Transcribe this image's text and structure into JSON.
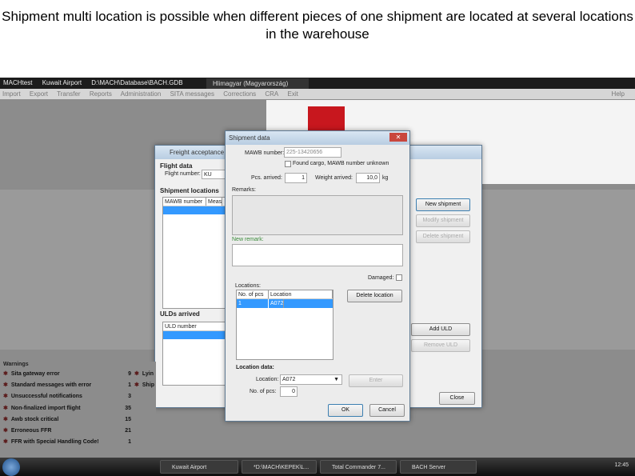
{
  "caption": "Shipment multi location is possible when different pieces of one shipment are located at several locations in the warehouse",
  "app": {
    "titlebar": [
      "MACHtest",
      "Kuwait Airport",
      "D:\\MACH\\Database\\BACH.GDB"
    ],
    "user": "Hlimagyar (Magyarország)",
    "menu": [
      "Import",
      "Export",
      "Transfer",
      "Reports",
      "Administration",
      "SITA messages",
      "Corrections",
      "CRA",
      "Exit"
    ],
    "help": "Help"
  },
  "freight": {
    "title": "Freight acceptance fo",
    "flight_data": "Flight data",
    "flight_number_label": "Flight number:",
    "flight_number": "KU",
    "shipment_locations": "Shipment locations",
    "cols": [
      "MAWB number",
      "Meas"
    ],
    "ulds_arrived": "ULDs arrived",
    "uld_col": "ULD number",
    "buttons": {
      "new": "New shipment",
      "modify": "Modify shipment",
      "delete": "Delete shipment",
      "add_uld": "Add ULD",
      "remove_uld": "Remove ULD",
      "close": "Close"
    }
  },
  "dialog": {
    "title": "Shipment data",
    "mawb_label": "MAWB number:",
    "mawb": "225-13420656",
    "found_cargo": "Found cargo, MAWB number unknown",
    "pcs_label": "Pcs. arrived:",
    "pcs": "1",
    "weight_label": "Weight arrived:",
    "weight": "10,0",
    "unit": "kg",
    "remarks": "Remarks:",
    "new_remark": "New remark:",
    "damaged": "Damaged:",
    "locations": "Locations:",
    "loc_cols": [
      "No. of pcs",
      "Location"
    ],
    "loc_rows": [
      {
        "pcs": "1",
        "location": "A072"
      }
    ],
    "delete_location": "Delete location",
    "location_data": "Location data:",
    "location_label": "Location:",
    "location": "A072",
    "enter": "Enter",
    "no_pcs_label": "No. of pcs:",
    "no_pcs": "0",
    "ok": "OK",
    "cancel": "Cancel"
  },
  "warnings": {
    "title": "Warnings",
    "items": [
      {
        "label": "Sita gateway error",
        "count": "9"
      },
      {
        "label": "Standard messages with error",
        "count": "1"
      },
      {
        "label": "Unsuccessful notifications",
        "count": "3"
      },
      {
        "label": "Non-finalized import flight",
        "count": "35"
      },
      {
        "label": "Awb stock critical",
        "count": "15"
      },
      {
        "label": "Erroneous FFR",
        "count": "21"
      },
      {
        "label": "FFR with Special Handling Code!",
        "count": "1"
      }
    ],
    "col2": [
      "Lyin",
      "Ship"
    ]
  },
  "taskbar": {
    "tasks": [
      "Kuwait Airport",
      "*D:\\MACH\\KEPEK\\L...",
      "Total Commander 7...",
      "BACH Server"
    ],
    "clock": "12:45"
  }
}
